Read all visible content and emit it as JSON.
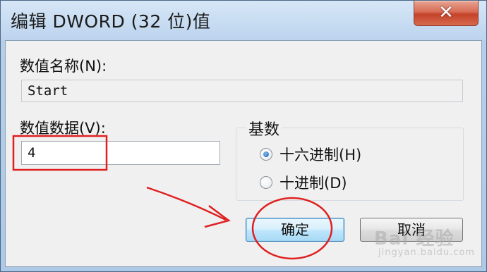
{
  "dialog": {
    "title": "编辑 DWORD (32 位)值",
    "close_symbol": "✕"
  },
  "value_name": {
    "label": "数值名称(N):",
    "value": "Start"
  },
  "value_data": {
    "label": "数值数据(V):",
    "value": "4"
  },
  "base": {
    "title": "基数",
    "options": [
      {
        "label": "十六进制(H)",
        "selected": true
      },
      {
        "label": "十进制(D)",
        "selected": false
      }
    ]
  },
  "buttons": {
    "ok": "确定",
    "cancel": "取消"
  },
  "watermark": {
    "text": "Bai 经验",
    "sub": "jingyan.baidu.com"
  },
  "colors": {
    "annotation": "#e02020",
    "selection": "#1a5fb4"
  }
}
